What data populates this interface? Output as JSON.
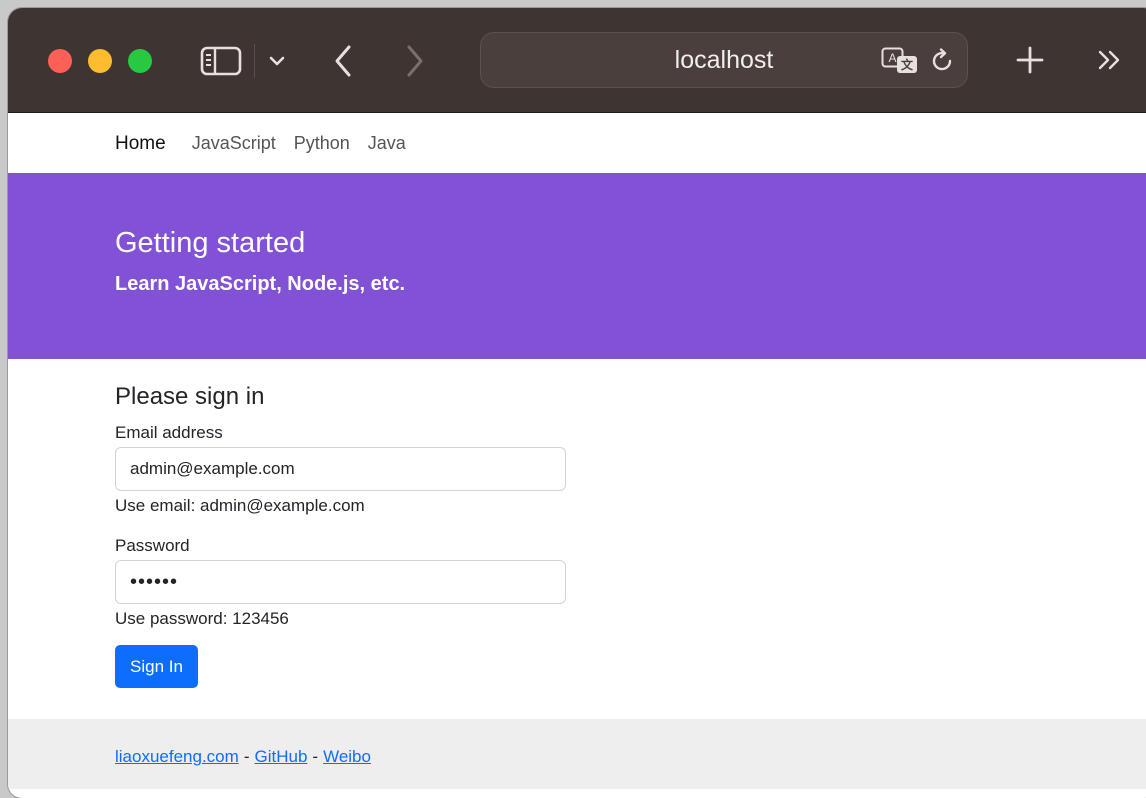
{
  "browser": {
    "address": "localhost"
  },
  "nav": {
    "items": [
      {
        "label": "Home",
        "active": true
      },
      {
        "label": "JavaScript",
        "active": false
      },
      {
        "label": "Python",
        "active": false
      },
      {
        "label": "Java",
        "active": false
      }
    ]
  },
  "hero": {
    "title": "Getting started",
    "subtitle": "Learn JavaScript, Node.js, etc.",
    "color": "#8151d6"
  },
  "form": {
    "title": "Please sign in",
    "email": {
      "label": "Email address",
      "value": "admin@example.com",
      "help": "Use email: admin@example.com"
    },
    "password": {
      "label": "Password",
      "value": "123456",
      "help": "Use password: 123456"
    },
    "submit_label": "Sign In",
    "submit_color": "#0d6efd"
  },
  "footer": {
    "links": [
      "liaoxuefeng.com",
      "GitHub",
      "Weibo"
    ],
    "separator": "-"
  }
}
